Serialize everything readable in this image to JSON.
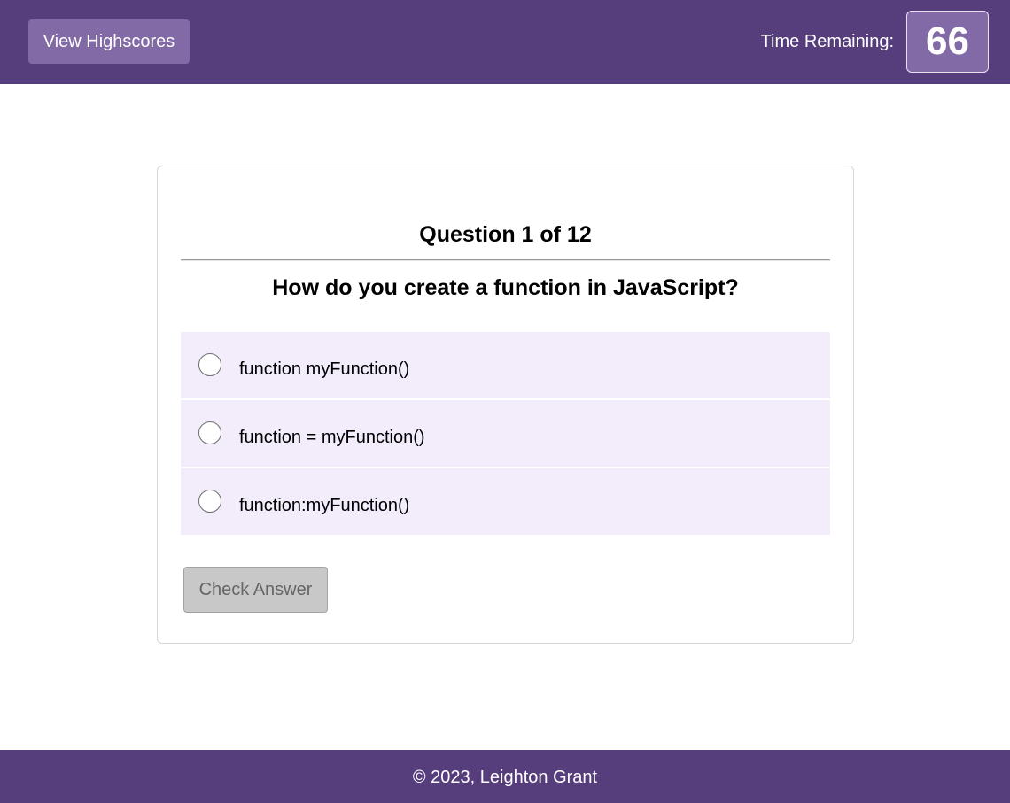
{
  "header": {
    "highscores_label": "View Highscores",
    "timer_label": "Time Remaining:",
    "timer_value": "66"
  },
  "quiz": {
    "counter": "Question 1 of 12",
    "question": "How do you create a function in JavaScript?",
    "options": [
      {
        "label": "function myFunction()",
        "selected": false
      },
      {
        "label": "function = myFunction()",
        "selected": false
      },
      {
        "label": "function:myFunction()",
        "selected": false
      }
    ],
    "check_label": "Check Answer",
    "check_enabled": false
  },
  "footer": {
    "text": "© 2023, Leighton Grant"
  },
  "colors": {
    "brand": "#563d7c",
    "brand_light": "#826aa6",
    "option_bg": "#f3edfb",
    "disabled_button": "#c8c8c8"
  }
}
